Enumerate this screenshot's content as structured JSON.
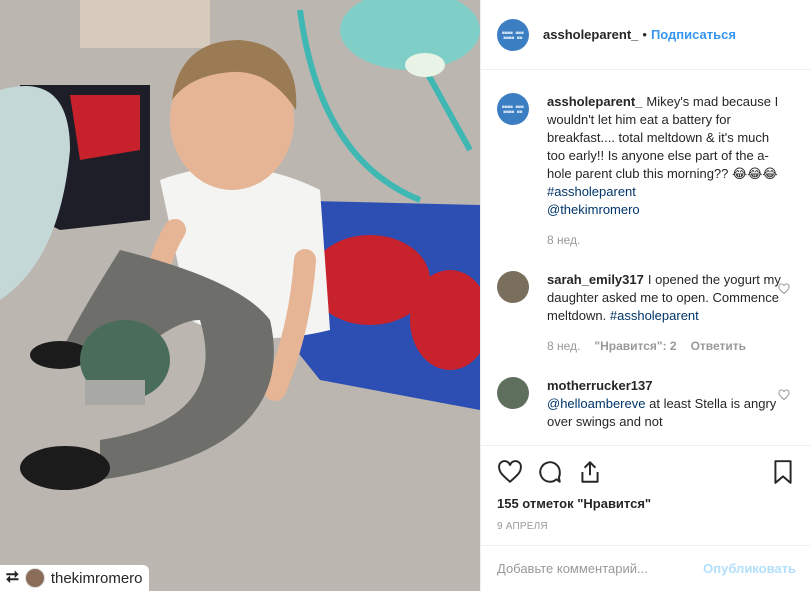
{
  "photo": {
    "repost_user": "thekimromero",
    "repost_icon": "repost-icon"
  },
  "header": {
    "username": "assholeparent_",
    "separator": "•",
    "follow_label": "Подписаться",
    "avatar_icon": "assholeparent-logo-avatar"
  },
  "caption": {
    "username": "assholeparent_",
    "text": "Mikey's mad because I wouldn't let him eat a battery for breakfast.... total meltdown & it's much too early!! Is anyone else part of the a-hole parent club this morning?? 😂😂😂",
    "hashtag": "#assholeparent",
    "mention": "@thekimromero",
    "time": "8 нед."
  },
  "comments": [
    {
      "username": "sarah_emily317",
      "text": "I opened the yogurt my daughter asked me to open. Commence meltdown.",
      "hashtag": "#assholeparent",
      "time": "8 нед.",
      "likes": "\"Нравится\": 2",
      "reply_label": "Ответить"
    },
    {
      "username": "motherrucker137",
      "mention": "@helloambereve",
      "text": "at least Stella is angry over swings and not"
    }
  ],
  "actions": {
    "like_icon": "heart-icon",
    "comment_icon": "comment-icon",
    "share_icon": "share-icon",
    "save_icon": "bookmark-icon",
    "likes_text": "155 отметок \"Нравится\"",
    "date": "9 АПРЕЛЯ"
  },
  "add_comment": {
    "placeholder": "Добавьте комментарий...",
    "post_label": "Опубликовать"
  },
  "colors": {
    "accent": "#3897f0",
    "post_disabled": "#b2dffc",
    "meta": "#999999",
    "border": "#efefef"
  }
}
